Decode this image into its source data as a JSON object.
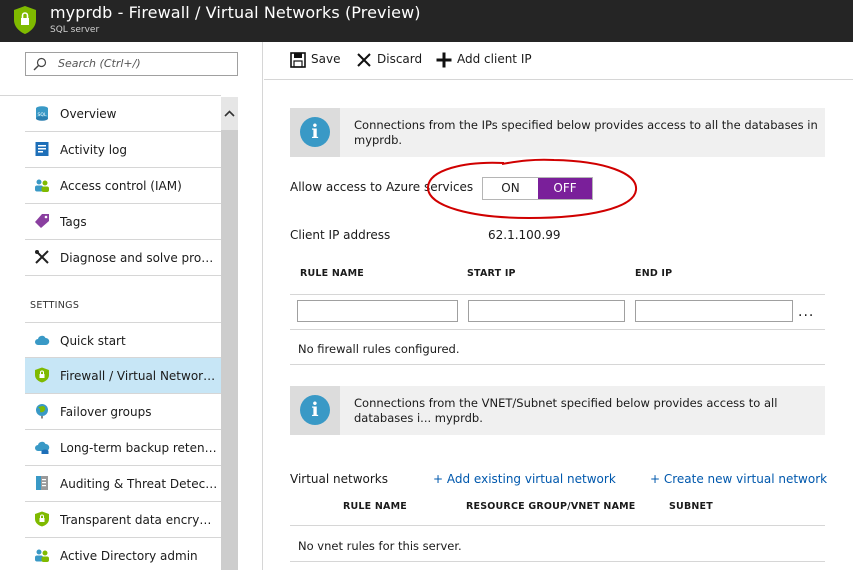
{
  "header": {
    "title": "myprdb - Firewall / Virtual Networks (Preview)",
    "subtitle": "SQL server",
    "icon": "shield-icon",
    "accent": "#7fba00"
  },
  "search": {
    "placeholder": "Search (Ctrl+/)"
  },
  "sidebar": {
    "items": [
      {
        "label": "Overview",
        "icon": "sql-database-icon"
      },
      {
        "label": "Activity log",
        "icon": "activity-log-icon"
      },
      {
        "label": "Access control (IAM)",
        "icon": "users-icon"
      },
      {
        "label": "Tags",
        "icon": "tag-icon"
      },
      {
        "label": "Diagnose and solve problems",
        "icon": "wrench-icon"
      }
    ],
    "settings_header": "SETTINGS",
    "settings_items": [
      {
        "label": "Quick start",
        "icon": "cloud-icon"
      },
      {
        "label": "Firewall / Virtual Networks (Preview)",
        "icon": "shield-icon",
        "active": true
      },
      {
        "label": "Failover groups",
        "icon": "globe-icon"
      },
      {
        "label": "Long-term backup retention",
        "icon": "cloud-backup-icon"
      },
      {
        "label": "Auditing & Threat Detection",
        "icon": "audit-icon"
      },
      {
        "label": "Transparent data encryption",
        "icon": "shield-icon"
      },
      {
        "label": "Active Directory admin",
        "icon": "ad-admin-icon"
      }
    ]
  },
  "toolbar": {
    "save_label": "Save",
    "discard_label": "Discard",
    "add_client_ip_label": "Add client IP"
  },
  "firewall": {
    "info_text": "Connections from the IPs specified below provides access to all the databases in myprdb.",
    "allow_azure_label": "Allow access to Azure services",
    "toggle_on": "ON",
    "toggle_off": "OFF",
    "toggle_selected": "OFF",
    "toggle_color": "#7a1f9a",
    "client_ip_label": "Client IP address",
    "client_ip_value": "62.1.100.99",
    "columns": [
      "RULE NAME",
      "START IP",
      "END IP"
    ],
    "more_label": "...",
    "empty_message": "No firewall rules configured."
  },
  "vnet": {
    "info_text": "Connections from the VNET/Subnet specified below provides access to all databases i... myprdb.",
    "section_label": "Virtual networks",
    "add_existing_link": "+ Add existing virtual network",
    "create_new_link": "+ Create new virtual network",
    "columns": [
      "RULE NAME",
      "RESOURCE GROUP/VNET NAME",
      "SUBNET"
    ],
    "empty_message": "No vnet rules for this server."
  }
}
